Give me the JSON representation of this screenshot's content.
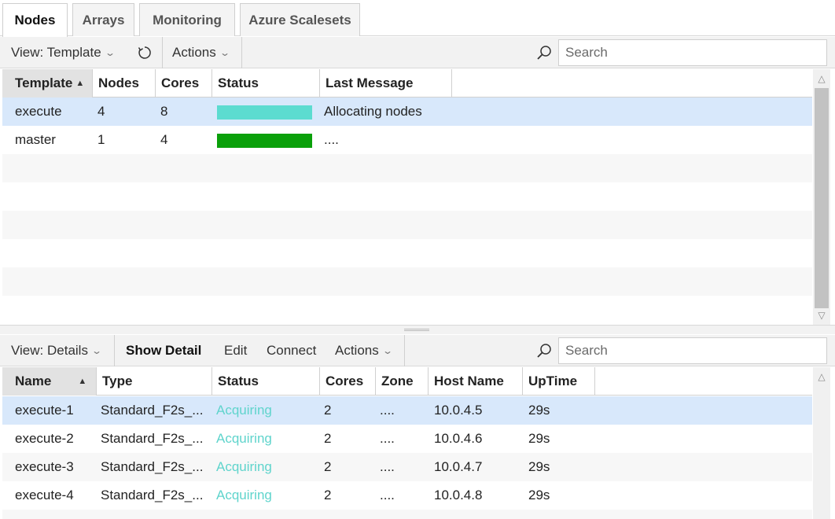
{
  "tabs": [
    {
      "label": "Nodes"
    },
    {
      "label": "Arrays"
    },
    {
      "label": "Monitoring"
    },
    {
      "label": "Azure Scalesets"
    }
  ],
  "top_toolbar": {
    "view_label": "View: Template",
    "actions_label": "Actions",
    "search_placeholder": "Search"
  },
  "templates_grid": {
    "columns": [
      "Template",
      "Nodes",
      "Cores",
      "Status",
      "Last Message"
    ],
    "rows": [
      {
        "template": "execute",
        "nodes": "4",
        "cores": "8",
        "status_color": "#5cdcd0",
        "status_fill": 1.0,
        "message": "Allocating nodes"
      },
      {
        "template": "master",
        "nodes": "1",
        "cores": "4",
        "status_color": "#0aa00a",
        "status_fill": 1.0,
        "message": "...."
      }
    ]
  },
  "bottom_toolbar": {
    "view_label": "View: Details",
    "show_detail_label": "Show Detail",
    "edit_label": "Edit",
    "connect_label": "Connect",
    "actions_label": "Actions",
    "search_placeholder": "Search"
  },
  "nodes_grid": {
    "columns": [
      "Name",
      "Type",
      "Status",
      "Cores",
      "Zone",
      "Host Name",
      "UpTime"
    ],
    "rows": [
      {
        "name": "execute-1",
        "type": "Standard_F2s_...",
        "status": "Acquiring",
        "cores": "2",
        "zone": "....",
        "host": "10.0.4.5",
        "uptime": "29s"
      },
      {
        "name": "execute-2",
        "type": "Standard_F2s_...",
        "status": "Acquiring",
        "cores": "2",
        "zone": "....",
        "host": "10.0.4.6",
        "uptime": "29s"
      },
      {
        "name": "execute-3",
        "type": "Standard_F2s_...",
        "status": "Acquiring",
        "cores": "2",
        "zone": "....",
        "host": "10.0.4.7",
        "uptime": "29s"
      },
      {
        "name": "execute-4",
        "type": "Standard_F2s_...",
        "status": "Acquiring",
        "cores": "2",
        "zone": "....",
        "host": "10.0.4.8",
        "uptime": "29s"
      }
    ]
  },
  "colors": {
    "selected_row": "#d8e8fb",
    "acquiring_text": "#5fd4cc"
  }
}
